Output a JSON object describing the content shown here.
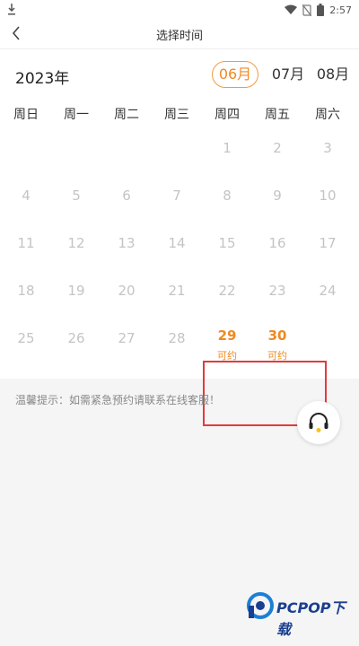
{
  "status_bar": {
    "time": "2:57"
  },
  "header": {
    "title": "选择时间"
  },
  "calendar": {
    "year": "2023年",
    "months": [
      {
        "label": "06月",
        "selected": true
      },
      {
        "label": "07月",
        "selected": false
      },
      {
        "label": "08月",
        "selected": false
      }
    ],
    "weekdays": [
      "周日",
      "周一",
      "周二",
      "周三",
      "周四",
      "周五",
      "周六"
    ],
    "weeks": [
      [
        null,
        null,
        null,
        null,
        "1",
        "2",
        "3"
      ],
      [
        "4",
        "5",
        "6",
        "7",
        "8",
        "9",
        "10"
      ],
      [
        "11",
        "12",
        "13",
        "14",
        "15",
        "16",
        "17"
      ],
      [
        "18",
        "19",
        "20",
        "21",
        "22",
        "23",
        "24"
      ],
      [
        "25",
        "26",
        "27",
        "28",
        "29",
        "30",
        null
      ]
    ],
    "available_days": [
      "29",
      "30"
    ],
    "available_label": "可约"
  },
  "tip": "温馨提示：如需紧急预约请联系在线客服！",
  "colors": {
    "accent": "#ee8a23",
    "highlight": "#e23b3b"
  },
  "icons": [
    "download-icon",
    "wifi-icon",
    "no-sim-icon",
    "battery-icon",
    "back-chevron-icon",
    "headset-icon"
  ],
  "watermark": {
    "text": "PCPOP下载"
  }
}
